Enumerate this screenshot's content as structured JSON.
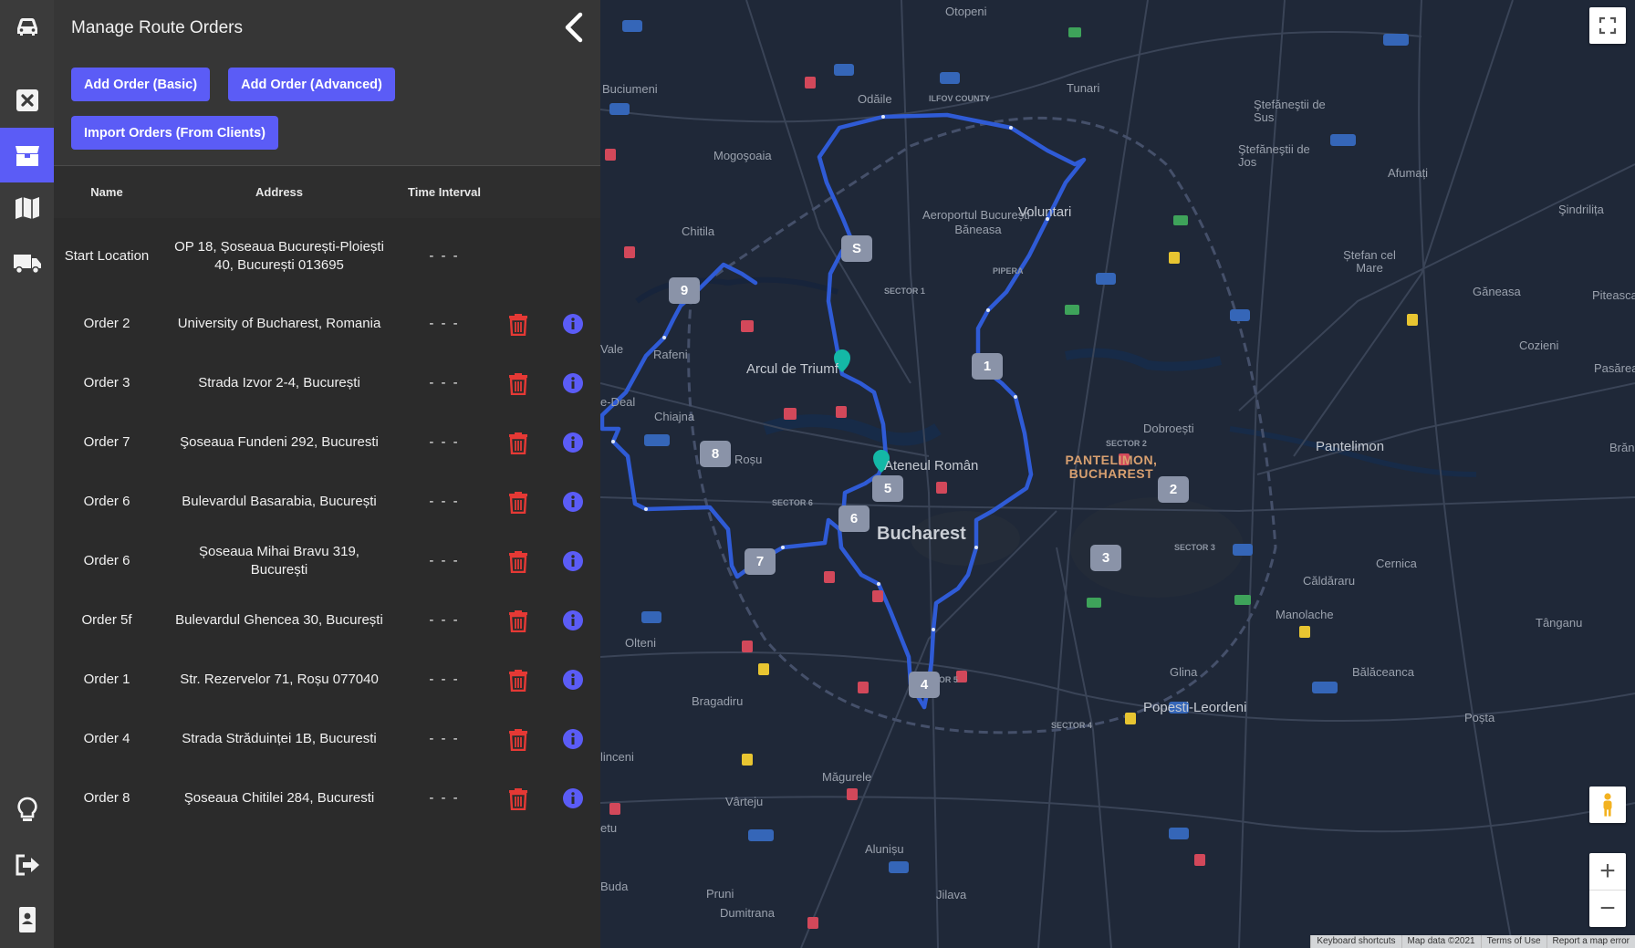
{
  "sidebar": {
    "items": [
      {
        "name": "car-icon"
      },
      {
        "name": "close-square-icon"
      },
      {
        "name": "box-icon",
        "active": true
      },
      {
        "name": "map-icon"
      },
      {
        "name": "truck-icon"
      },
      {
        "name": "lightbulb-icon"
      },
      {
        "name": "logout-icon"
      },
      {
        "name": "contact-badge-icon"
      }
    ],
    "accent": "#5b5cf6"
  },
  "panel": {
    "title": "Manage Route Orders",
    "buttons": {
      "add_basic": "Add Order (Basic)",
      "add_advanced": "Add Order (Advanced)",
      "import": "Import Orders (From Clients)"
    },
    "columns": {
      "name": "Name",
      "address": "Address",
      "time": "Time Interval"
    },
    "start": {
      "name": "Start Location",
      "address": "OP 18, Șoseaua București-Ploiești 40, București 013695",
      "time": "- - -"
    },
    "orders": [
      {
        "name": "Order 2",
        "address": "University of Bucharest, Romania",
        "time": "- - -"
      },
      {
        "name": "Order 3",
        "address": "Strada Izvor 2-4, București",
        "time": "- - -"
      },
      {
        "name": "Order 7",
        "address": "Şoseaua Fundeni 292, Bucuresti",
        "time": "- - -"
      },
      {
        "name": "Order 6",
        "address": "Bulevardul Basarabia, București",
        "time": "- - -"
      },
      {
        "name": "Order 6",
        "address": "Șoseaua Mihai Bravu 319, București",
        "time": "- - -"
      },
      {
        "name": "Order 5f",
        "address": "Bulevardul Ghencea 30, București",
        "time": "- - -"
      },
      {
        "name": "Order 1",
        "address": "Str. Rezervelor 71, Roșu 077040",
        "time": "- - -"
      },
      {
        "name": "Order 4",
        "address": "Strada Străduinței 1B, Bucuresti",
        "time": "- - -"
      },
      {
        "name": "Order 8",
        "address": "Şoseaua Chitilei 284, Bucuresti",
        "time": "- - -"
      }
    ],
    "delete_color": "#e53935",
    "info_color": "#5b5cf6"
  },
  "map": {
    "route_color": "#2f5bd6",
    "markers": [
      "S",
      "1",
      "2",
      "3",
      "4",
      "5",
      "6",
      "7",
      "8",
      "9"
    ],
    "places": {
      "otopeni": "Otopeni",
      "buciumeni": "Buciumeni",
      "odaile": "Odăile",
      "ilfov_county": "ILFOV COUNTY",
      "tunari": "Tunari",
      "stefanestii_sus": "Ştefăneştii de Sus",
      "stefanestii_jos": "Ştefăneştii de Jos",
      "afumati": "Afumați",
      "sindrilita": "Şindrilița",
      "mogosoaia": "Mogoşoaia",
      "voluntari": "Voluntari",
      "airport": "Aeroportul București-Băneasa",
      "chitila": "Chitila",
      "stefan_cel_mare": "Ștefan cel Mare",
      "ganeasa": "Găneasa",
      "pipera": "PIPERA",
      "piteasca": "Piteasca",
      "cozieni": "Cozieni",
      "pasarea": "Pasărea",
      "arcul": "Arcul de Triumf",
      "rosu": "Roșu",
      "chiajna": "Chiajna",
      "dobroesti": "Dobroești",
      "pantelimon_town": "Pantelimon",
      "branesti": "Brăn",
      "ateneul": "Ateneul Român",
      "pantelimon_district": "PANTELIMON, BUCHAREST",
      "bucharest": "Bucharest",
      "cernica": "Cernica",
      "caldararu": "Căldăraru",
      "manolache": "Manolache",
      "tanganu": "Tânganu",
      "olteni": "Olteni",
      "glina": "Glina",
      "balaceanca": "Bălăceanca",
      "bragadiru": "Bragadiru",
      "popesti": "Popesti-Leordeni",
      "posta": "Poșta",
      "magurele": "Măgurele",
      "varteju": "Vârteju",
      "alunisu": "Alunișu",
      "buda": "Buda",
      "pruni": "Pruni",
      "dumitrana": "Dumitrana",
      "jilava": "Jilava",
      "sector1": "SECTOR 1",
      "sector2": "SECTOR 2",
      "sector3": "SECTOR 3",
      "sector4": "SECTOR 4",
      "sector5": "SECTOR 5",
      "sector6": "SECTOR 6",
      "ravena": "Rafeni",
      "vale": "Vale",
      "dea": "e-Deal",
      "linceni": "linceni",
      "etu": "etu"
    },
    "controls": {
      "zoom_in": "+",
      "zoom_out": "−"
    },
    "attribution": {
      "shortcuts": "Keyboard shortcuts",
      "data": "Map data ©2021",
      "terms": "Terms of Use",
      "report": "Report a map error"
    }
  }
}
